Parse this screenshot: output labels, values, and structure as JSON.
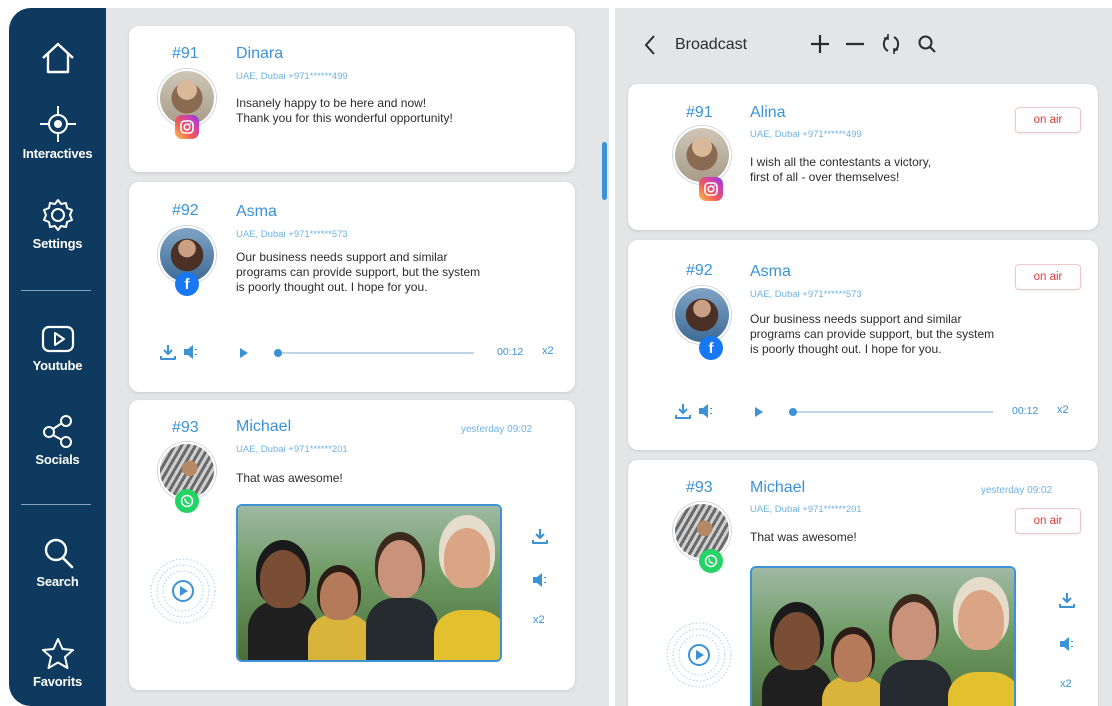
{
  "sidebar": {
    "items": [
      {
        "label": ""
      },
      {
        "label": "Interactives"
      },
      {
        "label": "Settings"
      },
      {
        "label": "Youtube"
      },
      {
        "label": "Socials"
      },
      {
        "label": "Search"
      },
      {
        "label": "Favorits"
      }
    ]
  },
  "left_feed": [
    {
      "num": "#91",
      "name": "Dinara",
      "meta": "UAE, Dubai   +971******499",
      "line1": "Insanely happy to be here and now!",
      "line2": "Thank you for this wonderful opportunity!",
      "network": "instagram"
    },
    {
      "num": "#92",
      "name": "Asma",
      "meta": "UAE, Dubai   +971******573",
      "line1": "Our business needs support and similar",
      "line2": "programs can provide support, but the system",
      "line3": "is poorly thought out. I hope for you.",
      "network": "facebook",
      "duration": "00:12",
      "speed": "x2"
    },
    {
      "num": "#93",
      "name": "Michael",
      "meta": "UAE, Dubai   +971******201",
      "line1": "That was awesome!",
      "time": "yesterday 09:02",
      "network": "whatsapp",
      "speed": "x2"
    }
  ],
  "broadcast": {
    "title": "Broadcast",
    "items": [
      {
        "num": "#91",
        "name": "Alina",
        "meta": "UAE, Dubai   +971******499",
        "line1": "I wish all the contestants a victory,",
        "line2": "first of all - over themselves!",
        "status": "on air",
        "network": "instagram"
      },
      {
        "num": "#92",
        "name": "Asma",
        "meta": "UAE, Dubai   +971******573",
        "line1": "Our business needs support and similar",
        "line2": "programs can provide support, but the system",
        "line3": "is poorly thought out. I hope for you.",
        "status": "on air",
        "network": "facebook",
        "duration": "00:12",
        "speed": "x2"
      },
      {
        "num": "#93",
        "name": "Michael",
        "meta": "UAE, Dubai   +971******201",
        "line1": "That was awesome!",
        "time": "yesterday 09:02",
        "status": "on air",
        "network": "whatsapp",
        "speed": "x2"
      }
    ]
  },
  "colors": {
    "sidebar": "#0d3a5e",
    "accent": "#3b93d6",
    "onair": "#e03b3b"
  }
}
